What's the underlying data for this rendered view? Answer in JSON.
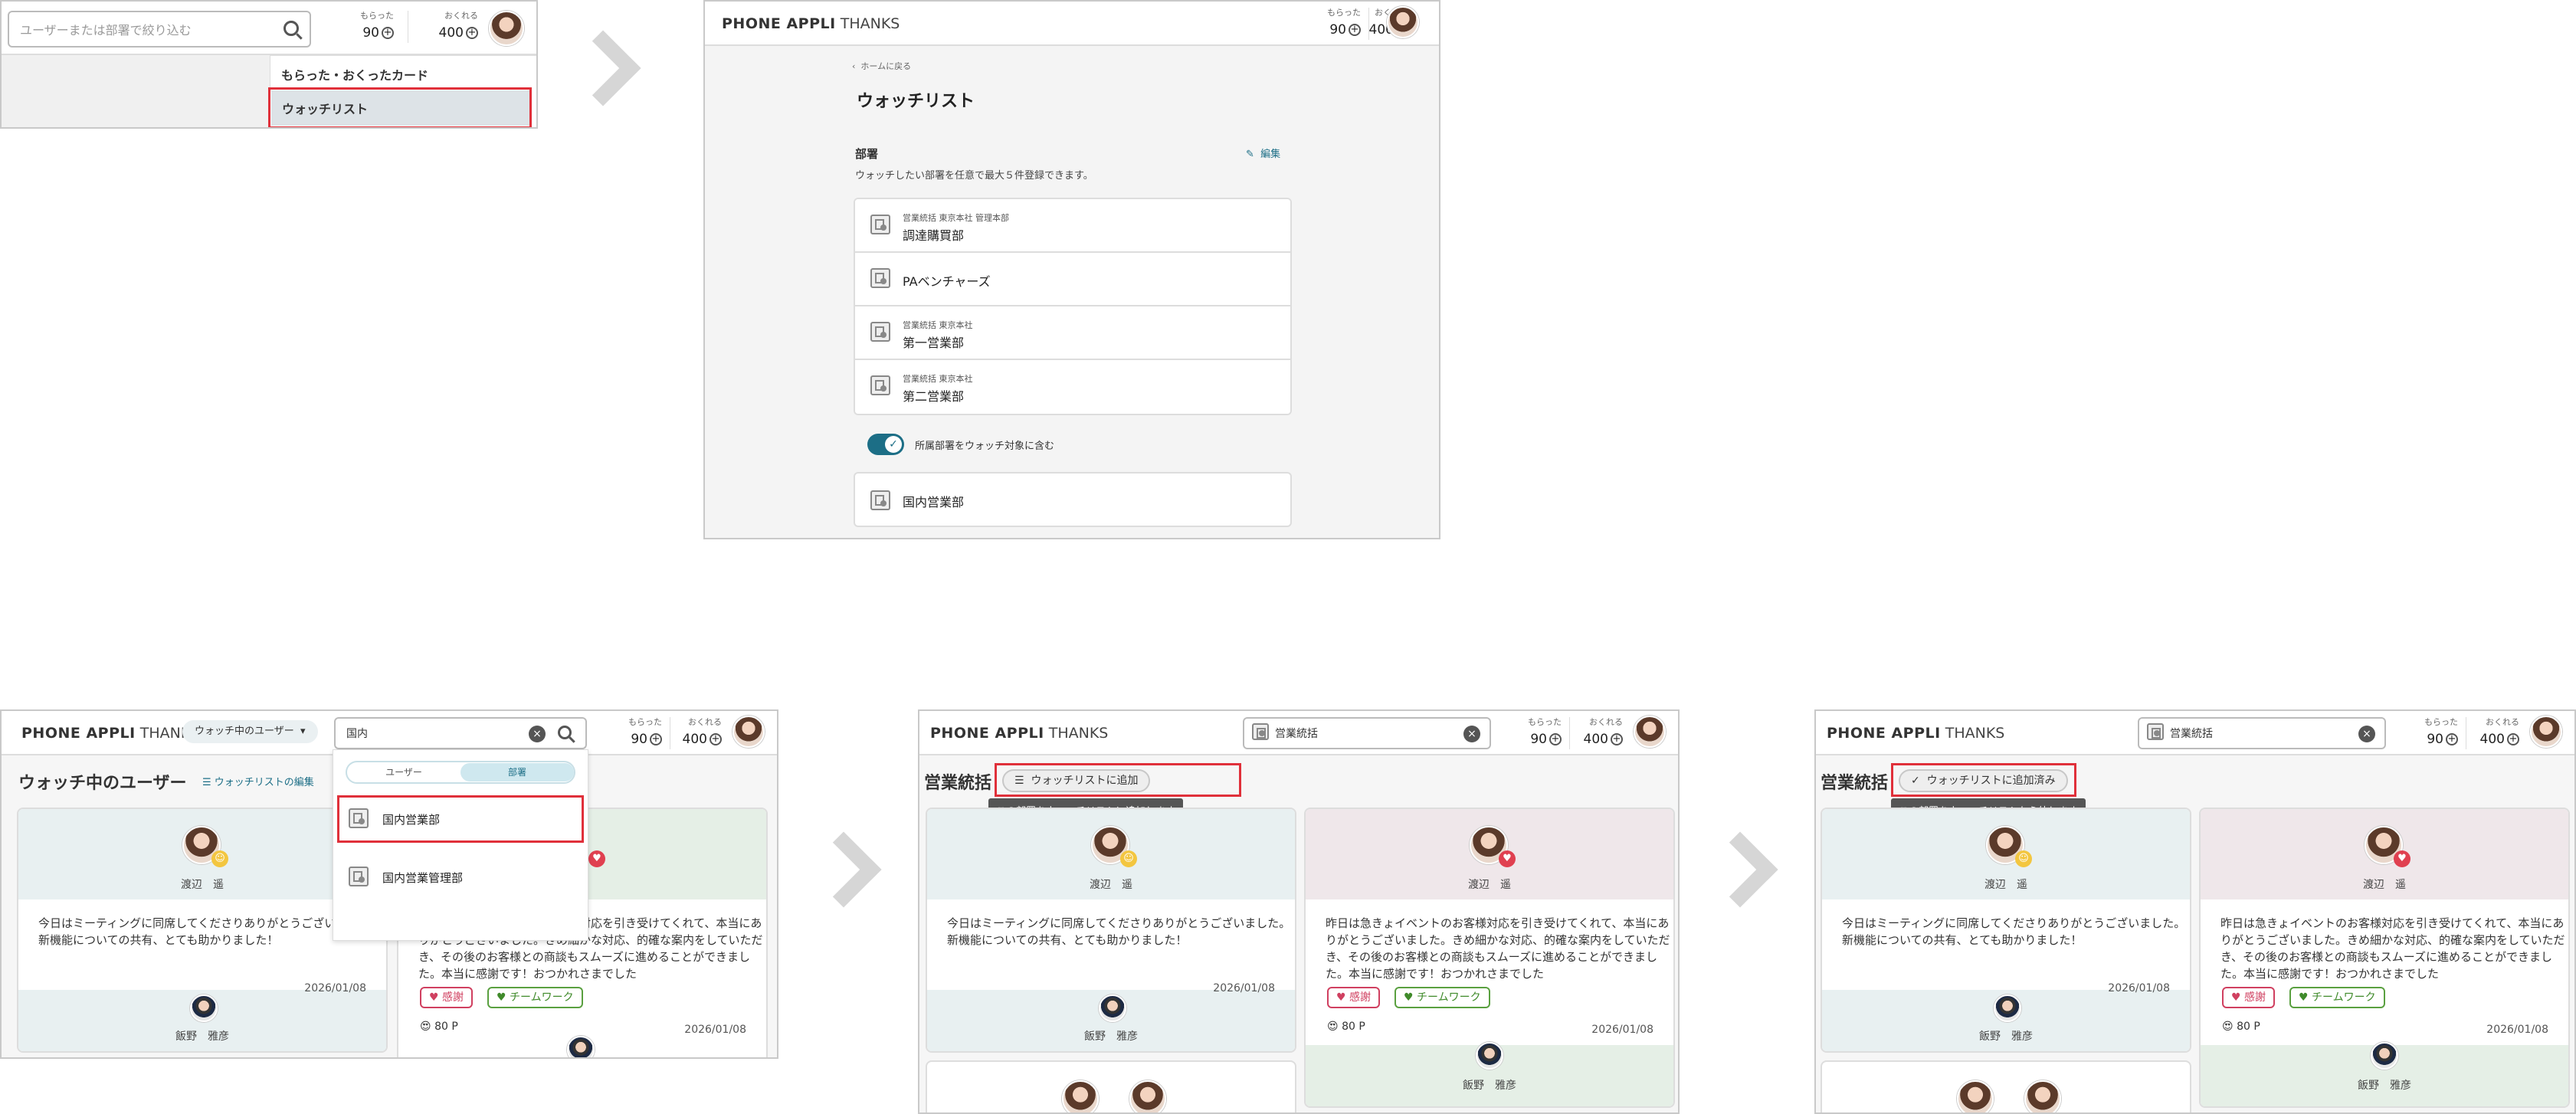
{
  "app": {
    "brand": "PHONE APPLI",
    "product": "THANKS"
  },
  "stats": {
    "received_label": "もらった",
    "received_value": "90",
    "send_label": "おくれる",
    "send_value": "400"
  },
  "panel1": {
    "search_placeholder": "ユーザーまたは部署で絞り込む",
    "menu": [
      "もらった・おくったカード",
      "ウォッチリスト"
    ]
  },
  "panel2": {
    "back": "ホームに戻る",
    "title": "ウォッチリスト",
    "section": "部署",
    "edit": "編集",
    "desc": "ウォッチしたい部署を任意で最大５件登録できます。",
    "departments": [
      {
        "path": "営業統括 東京本社 管理本部",
        "name": "調達購買部"
      },
      {
        "path": "",
        "name": "PAベンチャーズ"
      },
      {
        "path": "営業統括 東京本社",
        "name": "第一営業部"
      },
      {
        "path": "営業統括 東京本社",
        "name": "第二営業部"
      }
    ],
    "toggle_label": "所属部署をウォッチ対象に含む",
    "own_department": "国内営業部"
  },
  "panel3": {
    "filter": "ウォッチ中のユーザー",
    "query": "国内",
    "heading": "ウォッチ中のユーザー",
    "edit_link": "ウォッチリストの編集",
    "seg": [
      "ユーザー",
      "部署"
    ],
    "results": [
      "国内営業部",
      "国内営業管理部"
    ]
  },
  "dept_query": "営業統括",
  "page_title": "営業統括",
  "add_button": "ウォッチリストに追加",
  "add_tip": "この部署をウォッチリストに追加します",
  "added_button": "ウォッチリストに追加済み",
  "added_tip": "この部署をウォッチリストから外します",
  "cards": {
    "c1": {
      "to": "渡辺　遥",
      "msg": "今日はミーティングに同席してくださりありがとうございました。\n新機能についての共有、とても助かりました！",
      "date": "2026/01/08",
      "from": "飯野　雅彦"
    },
    "c2": {
      "to": "渡辺　遥",
      "msg": "昨日は急きょイベントのお客様対応を引き受けてくれて、本当にあ\nりがとうございました。きめ細かな対応、的確な案内をしていただ\nき、その後のお客様との商談もスムーズに進めることができまし\nた。本当に感謝です！おつかれさまでした",
      "tags": [
        "感謝",
        "チームワーク"
      ],
      "points": "80 P",
      "date": "2026/01/08",
      "from": "飯野　雅彦"
    }
  },
  "colors": {
    "accent": "#1c6e86",
    "highlight": "#e0303a"
  }
}
